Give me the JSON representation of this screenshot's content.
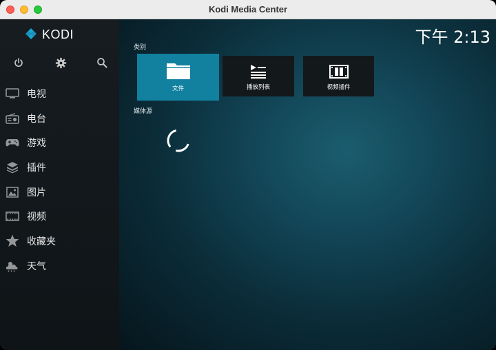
{
  "window": {
    "title": "Kodi Media Center"
  },
  "logo": {
    "text": "KODI"
  },
  "sidebar": {
    "top_buttons": [
      {
        "name": "power",
        "icon": "power-icon"
      },
      {
        "name": "settings",
        "icon": "gear-icon"
      },
      {
        "name": "search",
        "icon": "search-icon"
      }
    ],
    "items": [
      {
        "label": "电视",
        "icon": "tv-icon"
      },
      {
        "label": "电台",
        "icon": "radio-icon"
      },
      {
        "label": "游戏",
        "icon": "gamepad-icon"
      },
      {
        "label": "插件",
        "icon": "addons-box-icon"
      },
      {
        "label": "图片",
        "icon": "picture-icon"
      },
      {
        "label": "视频",
        "icon": "film-icon"
      },
      {
        "label": "收藏夹",
        "icon": "star-icon"
      },
      {
        "label": "天气",
        "icon": "weather-icon"
      }
    ]
  },
  "main": {
    "clock": "下午 2:13",
    "categories_heading": "类别",
    "tiles": [
      {
        "label": "文件",
        "icon": "folder-icon",
        "selected": true
      },
      {
        "label": "播放列表",
        "icon": "playlist-icon",
        "selected": false
      },
      {
        "label": "视频插件",
        "icon": "video-addons-icon",
        "selected": false
      }
    ],
    "sources_heading": "媒体源",
    "loading": true
  },
  "colors": {
    "accent": "#12809f",
    "sidebar_bg": "#161c20",
    "tile_bg": "#13181b"
  }
}
